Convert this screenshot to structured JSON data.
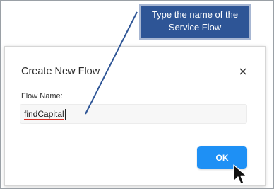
{
  "callout": {
    "line1": "Type the name of the",
    "line2": "Service Flow"
  },
  "dialog": {
    "title": "Create New Flow",
    "close_icon": "close-icon",
    "field_label": "Flow Name:",
    "field_value": "findCapital",
    "ok_label": "OK"
  },
  "colors": {
    "callout_bg": "#2e5596",
    "ok_button": "#1e90f5",
    "arrow": "#2e5596"
  },
  "cursor_icon": "mouse-pointer-icon"
}
